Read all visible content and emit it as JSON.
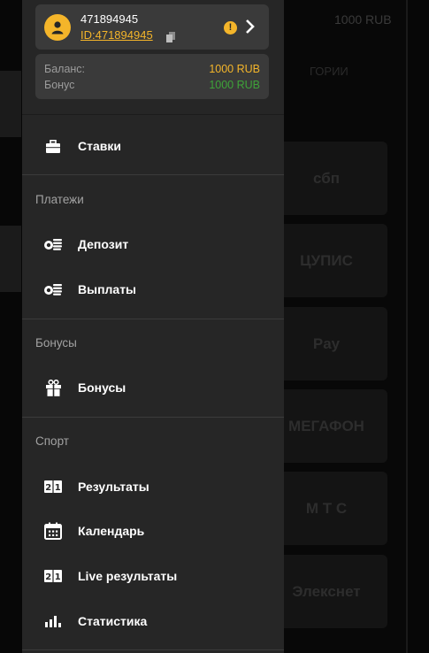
{
  "background": {
    "balance_text": "1000 RUB",
    "category_text": "ГОРИИ",
    "payment_cards": [
      "сбп",
      "ЦУПИС",
      "Pay",
      "МЕГАФОН",
      "М Т С",
      "Элекснет"
    ]
  },
  "profile": {
    "username": "471894945",
    "user_id": "ID:471894945",
    "warning_symbol": "!"
  },
  "balance": {
    "balance_label": "Баланс:",
    "balance_value": "1000 RUB",
    "bonus_label": "Бонус",
    "bonus_value": "1000 RUB"
  },
  "menu": {
    "bets": "Ставки",
    "payments_section": "Платежи",
    "deposit": "Депозит",
    "withdrawals": "Выплаты",
    "bonuses_section": "Бонусы",
    "bonuses": "Бонусы",
    "sport_section": "Спорт",
    "results": "Результаты",
    "calendar": "Календарь",
    "live_results": "Live результаты",
    "statistics": "Статистика"
  },
  "colors": {
    "accent": "#f4b52a",
    "bonus_green": "#3ea339",
    "drawer_bg": "#262626",
    "card_bg": "#3a3a3a"
  },
  "icons": {
    "bets": "briefcase-icon",
    "deposit": "coins-icon",
    "withdrawals": "coins-icon",
    "bonuses": "gift-icon",
    "results": "scoreboard-icon",
    "calendar": "calendar-icon",
    "live_results": "scoreboard-icon",
    "statistics": "bar-chart-icon"
  }
}
